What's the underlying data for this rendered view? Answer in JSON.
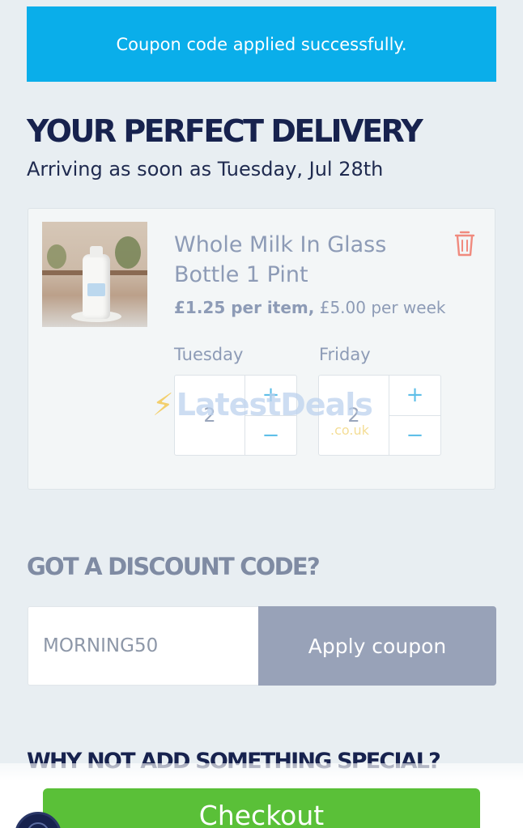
{
  "banner": {
    "message": "Coupon code applied successfully."
  },
  "delivery": {
    "title": "YOUR PERFECT DELIVERY",
    "arrival": "Arriving as soon as Tuesday, Jul 28th"
  },
  "product": {
    "name": "Whole Milk In Glass Bottle 1 Pint",
    "price_per_item": "£1.25 per item,",
    "price_per_week": " £5.00 per week",
    "schedule": [
      {
        "day": "Tuesday",
        "quantity": "2",
        "plus": "+",
        "minus": "−"
      },
      {
        "day": "Friday",
        "quantity": "2",
        "plus": "+",
        "minus": "−"
      }
    ],
    "trash_color": "#f08a7e"
  },
  "watermark": {
    "brand": "LatestDeals",
    "domain": ".co.uk"
  },
  "discount": {
    "title": "GOT A DISCOUNT CODE?",
    "code_value": "MORNING50",
    "apply_label": "Apply coupon"
  },
  "special": {
    "title": "WHY NOT ADD SOMETHING SPECIAL?"
  },
  "checkout": {
    "label": "Checkout",
    "color": "#5ac038"
  },
  "colors": {
    "banner": "#0aaeea",
    "navy": "#17224e"
  }
}
